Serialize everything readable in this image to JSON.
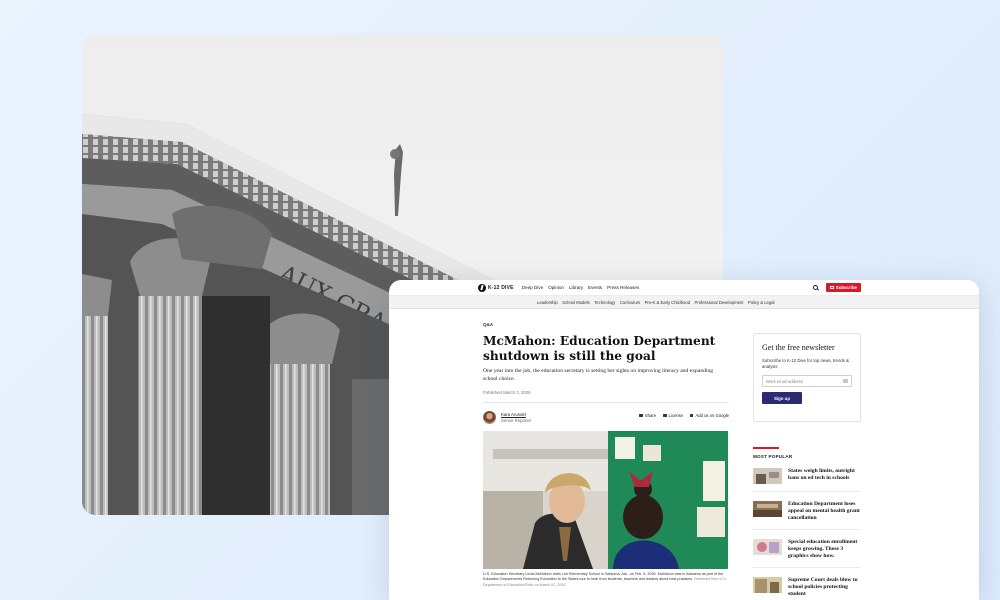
{
  "site": {
    "logo_text": "K-12 DIVE",
    "topnav": [
      "Deep Dive",
      "Opinion",
      "Library",
      "Events",
      "Press Releases"
    ],
    "subscribe_label": "Subscribe",
    "subnav": [
      "Leadership",
      "School Models",
      "Technology",
      "Curriculum",
      "Pre-K & Early Childhood",
      "Professional Development",
      "Policy & Legal"
    ]
  },
  "article": {
    "kicker": "Q&A",
    "headline": "McMahon: Education Department shutdown is still the goal",
    "dek": "One year into the job, the education secretary is setting her sights on improving literacy and expanding school choice.",
    "published": "Published March 3, 2026",
    "author": "Kara Arundel",
    "role": "Senior Reporter",
    "actions": [
      "Share",
      "License",
      "Add us on Google"
    ],
    "caption": "U.S. Education Secretary Linda McMahon visits Lee Elementary School in Satsuma, Ala., on Feb. 5, 2026. McMahon was in Alabama as part of the Education Department's Returning Education to the States tour to hear from students, teachers and leaders about best practices.",
    "caption_credit": "Retrieved from U.S. Department of Education/Flickr on March 02, 2026"
  },
  "newsletter": {
    "title": "Get the free newsletter",
    "description": "Subscribe to K-12 Dive for top news, trends & analysis",
    "placeholder": "Work email address",
    "button": "Sign up"
  },
  "popular": {
    "title": "MOST POPULAR",
    "items": [
      {
        "text": "States weigh limits, outright bans on ed tech in schools"
      },
      {
        "text": "Education Department loses appeal on mental health grant cancellation"
      },
      {
        "text": "Special education enrollment keeps growing. These 3 graphics show how."
      },
      {
        "text": "Supreme Court deals blow to school policies protecting student"
      }
    ]
  },
  "colors": {
    "accent": "#d7192a",
    "button": "#2b2a73",
    "background": "#e4effc"
  }
}
